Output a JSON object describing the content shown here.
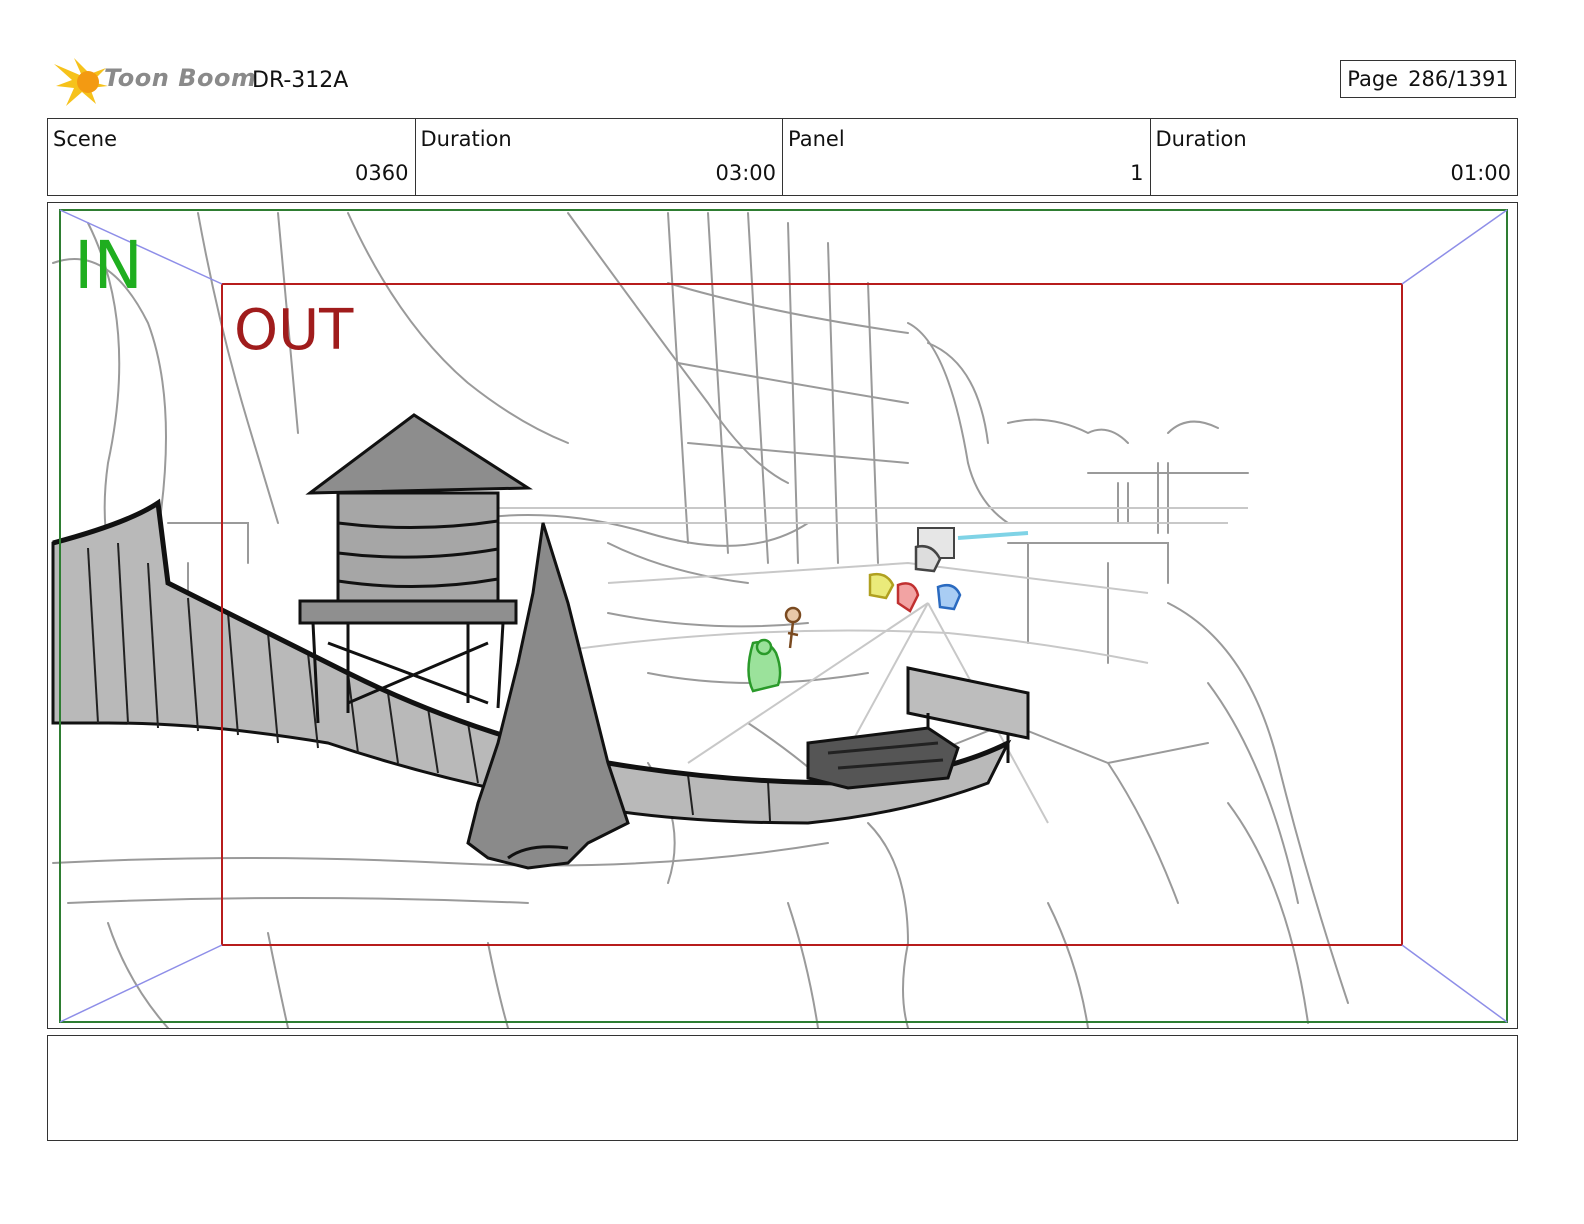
{
  "header": {
    "brand": "Toon Boom",
    "doc_id": "DR-312A",
    "page_label": "Page",
    "page_value": "286/1391"
  },
  "info": {
    "scene_label": "Scene",
    "scene_value": "0360",
    "scene_duration_label": "Duration",
    "scene_duration_value": "03:00",
    "panel_label": "Panel",
    "panel_value": "1",
    "panel_duration_label": "Duration",
    "panel_duration_value": "01:00"
  },
  "panel": {
    "in_label": "IN",
    "out_label": "OUT",
    "in_frame_color": "#2e7d32",
    "out_frame_color": "#b71c1c"
  },
  "notes": {
    "text": ""
  }
}
